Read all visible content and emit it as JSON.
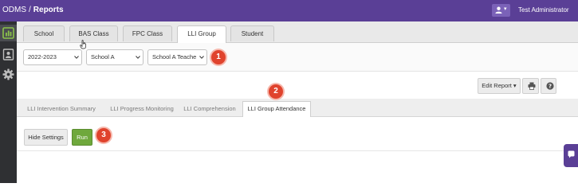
{
  "header": {
    "brand": "ODMS",
    "separator": "/",
    "page": "Reports",
    "user_name": "Test Administrator",
    "caret": "▾"
  },
  "sidebar": {
    "items": [
      {
        "icon": "bar-chart-icon",
        "active": true
      },
      {
        "icon": "contact-card-icon",
        "active": false
      },
      {
        "icon": "gear-icon",
        "active": false
      }
    ]
  },
  "main_tabs": [
    {
      "label": "School",
      "active": false
    },
    {
      "label": "BAS Class",
      "active": false
    },
    {
      "label": "FPC Class",
      "active": false
    },
    {
      "label": "LLI Group",
      "active": true
    },
    {
      "label": "Student",
      "active": false
    }
  ],
  "filters": {
    "year": "2022-2023",
    "school": "School A",
    "teacher": "School A Teache"
  },
  "toolbar": {
    "edit_report": "Edit Report",
    "edit_report_caret": "▾"
  },
  "sub_tabs": [
    {
      "label": "LLI Intervention Summary",
      "active": false
    },
    {
      "label": "LLI Progress Monitoring",
      "active": false
    },
    {
      "label": "LLI Comprehension",
      "active": false
    },
    {
      "label": "LLI Group Attendance",
      "active": true
    }
  ],
  "actions": {
    "hide_settings": "Hide Settings",
    "run": "Run"
  },
  "callouts": [
    "1",
    "2",
    "3"
  ],
  "colors": {
    "header_bg": "#5a3f96",
    "sidebar_bg": "#2f3033",
    "run_button": "#6fa83c",
    "callout": "#e0432d",
    "accent_green": "#8bc34a"
  }
}
